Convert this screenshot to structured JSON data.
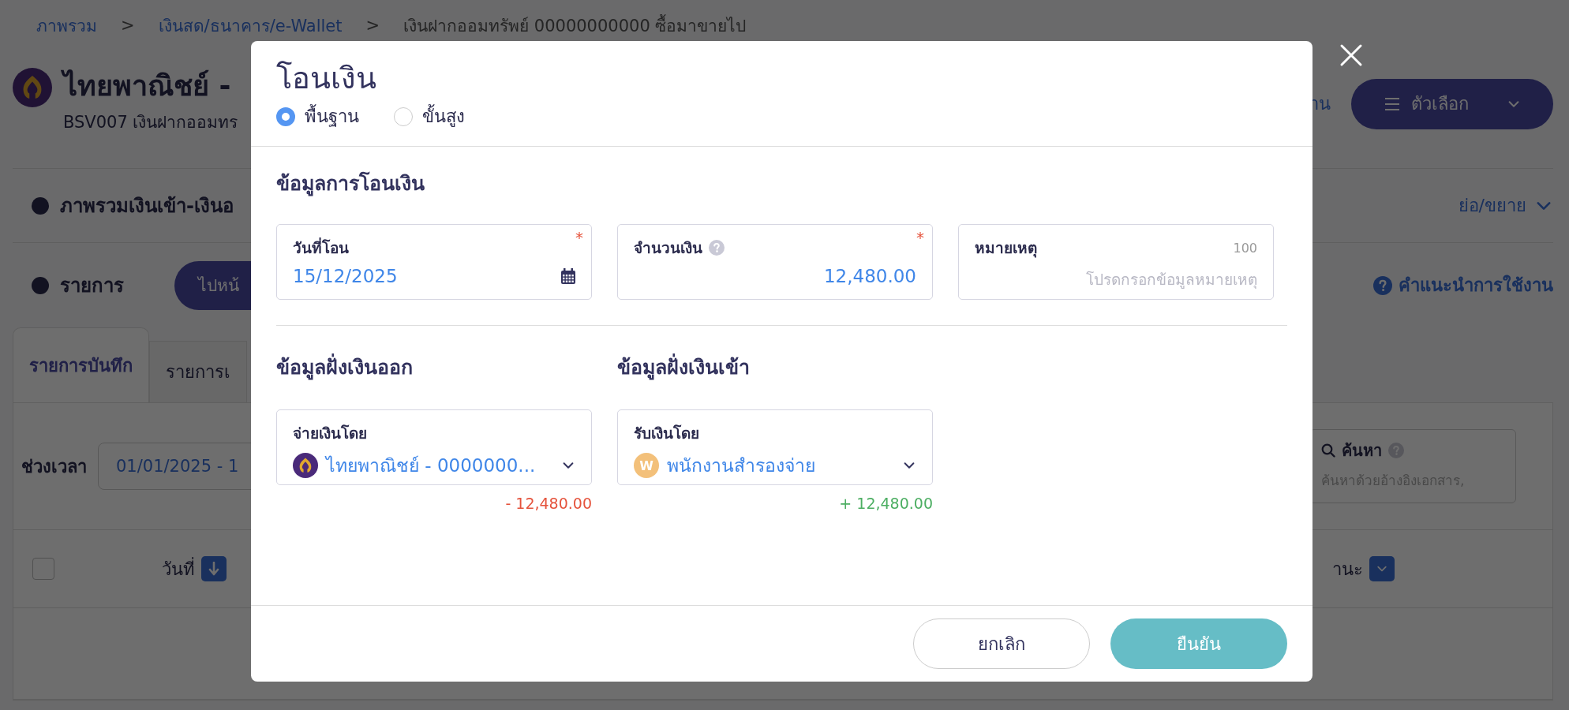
{
  "breadcrumb": [
    {
      "kind": "link",
      "label": "ภาพรวม"
    },
    {
      "kind": "separator",
      "label": ">"
    },
    {
      "kind": "link",
      "label": "เงินสด/ธนาคาร/e-Wallet"
    },
    {
      "kind": "separator",
      "label": ">"
    },
    {
      "kind": "current",
      "label": "เงินฝากออมทรัพย์ 00000000000 ซื้อมาขายไป"
    }
  ],
  "account": {
    "title": "ไทยพาณิชย์ -",
    "subtitle": "BSV007 เงินฝากออมทร"
  },
  "header_actions": {
    "link_fragment": "าน",
    "options_button": "ตัวเลือก"
  },
  "overview_section": {
    "title": "ภาพรวมเงินเข้า-เงินอ",
    "toggle": "ย่อ/ขยาย"
  },
  "list_section": {
    "title": "รายการ",
    "button": "ไปหน้",
    "help_link": "คำแนะนำการใช้งาน"
  },
  "tabs": [
    {
      "label": "รายการบันทึก",
      "selected": true
    },
    {
      "label": "รายการเ",
      "selected": false
    }
  ],
  "filters": {
    "period_label": "ช่วงเวลา",
    "period_value": "01/01/2025 - 1",
    "search_label": "ค้นหา",
    "search_placeholder": "ค้นหาด้วยอ้างอิงเอกสาร,"
  },
  "table": {
    "select_all": {
      "checked": false
    },
    "columns": [
      {
        "label": "วันที่",
        "kind": "sort"
      },
      {
        "label": "านะ",
        "kind": "filter"
      }
    ]
  },
  "dialog": {
    "title": "โอนเงิน",
    "modes": [
      {
        "label": "พื้นฐาน",
        "selected": true
      },
      {
        "label": "ขั้นสูง",
        "selected": false
      }
    ],
    "transfer_section": "ข้อมูลการโอนเงิน",
    "fields": [
      {
        "kind": "date",
        "label": "วันที่โอน",
        "value": "15/12/2025",
        "required_mark": "*"
      },
      {
        "kind": "amount",
        "label": "จำนวนเงิน",
        "value": "12,480.00",
        "required_mark": "*"
      },
      {
        "kind": "note",
        "label": "หมายเหตุ",
        "counter": "100",
        "placeholder": "โปรดกรอกข้อมูลหมายเหตุ"
      }
    ],
    "sides": [
      {
        "title": "ข้อมูลฝั่งเงินออก",
        "field_label": "จ่ายเงินโดย",
        "value": "ไทยพาณิชย์ - 0000000...",
        "avatar": {
          "kind": "bank"
        },
        "amount": "- 12,480.00",
        "kind": "debit"
      },
      {
        "title": "ข้อมูลฝั่งเงินเข้า",
        "field_label": "รับเงินโดย",
        "value": "พนักงานสำรองจ่าย",
        "avatar": {
          "kind": "letter",
          "letter": "W"
        },
        "amount": "+ 12,480.00",
        "kind": "credit"
      }
    ],
    "buttons": [
      {
        "kind": "secondary",
        "label": "ยกเลิก"
      },
      {
        "kind": "primary",
        "label": "ยืนยัน"
      }
    ]
  }
}
